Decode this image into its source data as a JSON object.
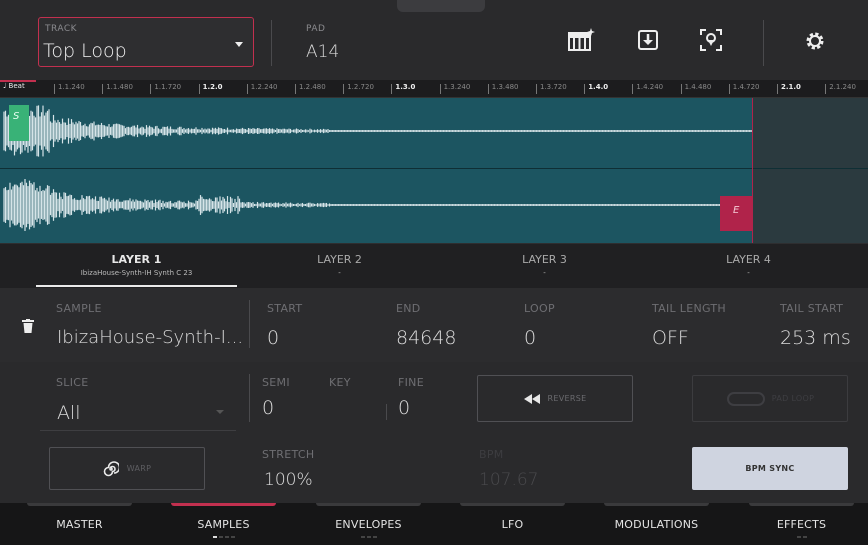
{
  "header": {
    "track_caption": "TRACK",
    "track_value": "Top Loop",
    "pad_caption": "PAD",
    "pad_value": "A14",
    "icons": [
      "keygroup-icon",
      "download-icon",
      "locate-icon",
      "gear-icon"
    ]
  },
  "ruler": {
    "beat_label": "Beat",
    "ticks": [
      "1.1.240",
      "1.1.480",
      "1.1.720",
      "1.2.0",
      "1.2.240",
      "1.2.480",
      "1.2.720",
      "1.3.0",
      "1.3.240",
      "1.3.480",
      "1.3.720",
      "1.4.0",
      "1.4.240",
      "1.4.480",
      "1.4.720",
      "2.1.0",
      "2.1.240",
      "2"
    ],
    "major": [
      "1.2.0",
      "1.3.0",
      "1.4.0",
      "2.1.0"
    ]
  },
  "waveform": {
    "start_marker": "S",
    "end_marker": "E",
    "bg_color": "#1c5561",
    "start_color": "#39b277",
    "end_color": "#b0234a"
  },
  "layers": [
    {
      "title": "LAYER 1",
      "subtitle": "IbizaHouse-Synth-IH Synth C 23"
    },
    {
      "title": "LAYER 2",
      "subtitle": "-"
    },
    {
      "title": "LAYER 3",
      "subtitle": "-"
    },
    {
      "title": "LAYER 4",
      "subtitle": "-"
    }
  ],
  "sample": {
    "sample_caption": "SAMPLE",
    "sample_value": "IbizaHouse-Synth-I...",
    "start_caption": "START",
    "start_value": "0",
    "end_caption": "END",
    "end_value": "84648",
    "loop_caption": "LOOP",
    "loop_value": "0",
    "tail_length_caption": "TAIL LENGTH",
    "tail_length_value": "OFF",
    "tail_start_caption": "TAIL START",
    "tail_start_value": "253 ms"
  },
  "controls": {
    "slice_caption": "SLICE",
    "slice_value": "All",
    "semi_caption": "SEMI",
    "semi_value": "0",
    "key_caption": "KEY",
    "fine_caption": "FINE",
    "fine_value": "0",
    "reverse_label": "REVERSE",
    "pad_loop_label": "PAD LOOP",
    "warp_label": "WARP",
    "stretch_caption": "STRETCH",
    "stretch_value": "100%",
    "bpm_caption": "BPM",
    "bpm_value": "107.67",
    "bpm_sync_label": "BPM SYNC"
  },
  "tabs": [
    {
      "label": "MASTER",
      "active": false,
      "dots": 0
    },
    {
      "label": "SAMPLES",
      "active": true,
      "dots": 4
    },
    {
      "label": "ENVELOPES",
      "active": false,
      "dots": 3
    },
    {
      "label": "LFO",
      "active": false,
      "dots": 0
    },
    {
      "label": "MODULATIONS",
      "active": false,
      "dots": 0
    },
    {
      "label": "EFFECTS",
      "active": false,
      "dots": 2
    }
  ]
}
